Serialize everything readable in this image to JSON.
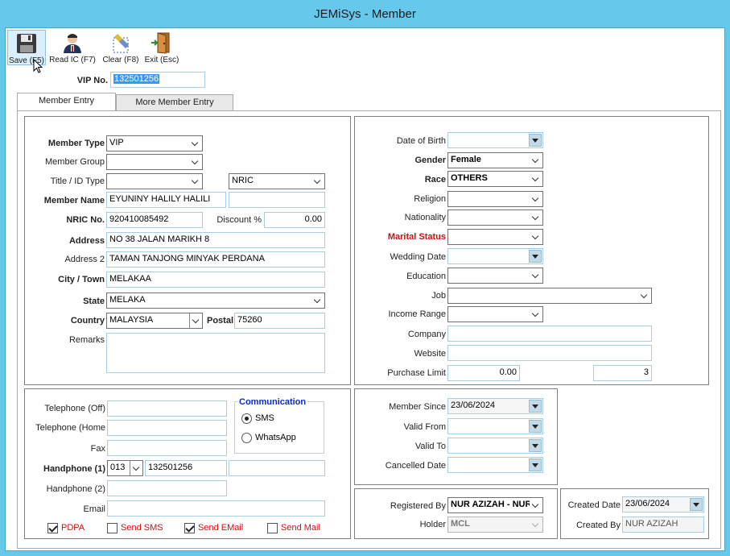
{
  "window": {
    "title": "JEMiSys - Member"
  },
  "toolbar": {
    "save": "Save (F5)",
    "read_ic": "Read IC (F7)",
    "clear": "Clear (F8)",
    "exit": "Exit (Esc)"
  },
  "vip": {
    "label": "VIP No.",
    "value": "132501256"
  },
  "tabs": {
    "member_entry": "Member Entry",
    "more_member_entry": "More Member Entry"
  },
  "left": {
    "member_type_label": "Member Type",
    "member_type": "VIP",
    "member_group_label": "Member Group",
    "member_group": "",
    "title_id_label": "Title / ID Type",
    "title": "",
    "id_type": "NRIC",
    "member_name_label": "Member Name",
    "member_name": "EYUNINY HALILY HALILI",
    "member_name2": "",
    "nric_label": "NRIC No.",
    "nric": "920410085492",
    "discount_label": "Discount %",
    "discount": "0.00",
    "address_label": "Address",
    "address": "NO 38 JALAN MARIKH 8",
    "address2_label": "Address 2",
    "address2": "TAMAN TANJONG MINYAK PERDANA",
    "city_label": "City / Town",
    "city": "MELAKAA",
    "state_label": "State",
    "state": "MELAKA",
    "country_label": "Country",
    "country": "MALAYSIA",
    "postal_label": "Postal",
    "postal": "75260",
    "remarks_label": "Remarks",
    "remarks": ""
  },
  "right": {
    "dob_label": "Date of Birth",
    "dob": "",
    "gender_label": "Gender",
    "gender": "Female",
    "race_label": "Race",
    "race": "OTHERS",
    "religion_label": "Religion",
    "religion": "",
    "nationality_label": "Nationality",
    "nationality": "",
    "marital_label": "Marital Status",
    "marital": "",
    "wedding_label": "Wedding Date",
    "wedding": "",
    "education_label": "Education",
    "education": "",
    "job_label": "Job",
    "job": "",
    "income_label": "Income Range",
    "income": "",
    "company_label": "Company",
    "company": "",
    "website_label": "Website",
    "website": "",
    "purchase_limit_label": "Purchase Limit",
    "purchase_limit": "0.00",
    "purchase_limit2": "3"
  },
  "contact": {
    "tel_off_label": "Telephone (Off)",
    "tel_off": "",
    "tel_home_label": "Telephone (Home",
    "tel_home": "",
    "fax_label": "Fax",
    "fax": "",
    "hp1_label": "Handphone (1)",
    "hp1_code": "013",
    "hp1": "132501256",
    "hp1_extra": "",
    "hp2_label": "Handphone (2)",
    "hp2": "",
    "email_label": "Email",
    "email": "",
    "communication_label": "Communication",
    "sms": "SMS",
    "whatsapp": "WhatsApp",
    "pdpa": "PDPA",
    "send_sms": "Send SMS",
    "send_email": "Send EMail",
    "send_mail": "Send Mail"
  },
  "membership": {
    "member_since_label": "Member Since",
    "member_since": "23/06/2024",
    "valid_from_label": "Valid From",
    "valid_from": "",
    "valid_to_label": "Valid To",
    "valid_to": "",
    "cancelled_label": "Cancelled Date",
    "cancelled": ""
  },
  "registration": {
    "registered_by_label": "Registered By",
    "registered_by": "NUR AZIZAH - NUR A",
    "holder_label": "Holder",
    "holder": "MCL"
  },
  "creation": {
    "created_date_label": "Created Date",
    "created_date": "23/06/2024",
    "created_by_label": "Created By",
    "created_by": "NUR AZIZAH"
  },
  "colors": {
    "title_bar": "#66c9ec",
    "required_red": "#d01010",
    "communication_blue": "#0a2bc4",
    "selection": "#3399ff"
  },
  "icons": {
    "save": "floppy-disk-icon",
    "read_ic": "user-card-icon",
    "clear": "eraser-icon",
    "exit": "exit-door-icon",
    "cursor": "mouse-pointer-icon"
  }
}
